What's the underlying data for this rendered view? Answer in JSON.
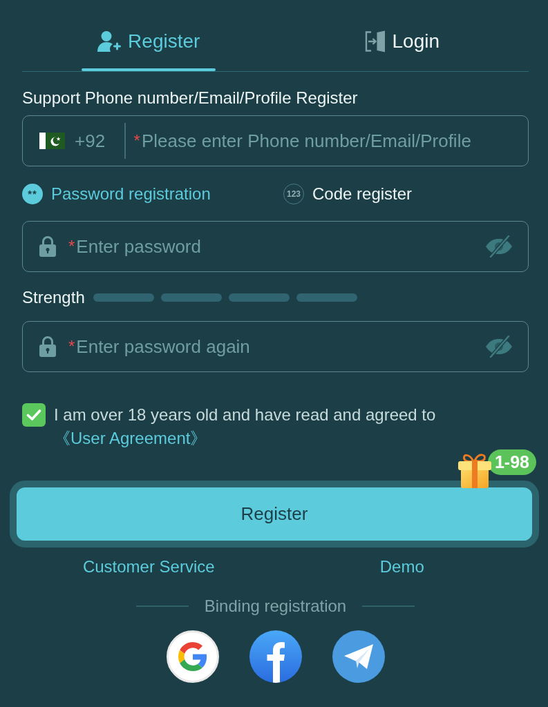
{
  "tabs": [
    {
      "label": "Register",
      "kind": "register",
      "selected": true
    },
    {
      "label": "Login",
      "kind": "login",
      "selected": false
    }
  ],
  "account": {
    "label": "Support Phone number/Email/Profile Register",
    "country_code": "+92",
    "required_mark": "*",
    "placeholder": "Please enter Phone number/Email/Profile"
  },
  "methods": [
    {
      "label": "Password registration",
      "icon_text": "**",
      "selected": true
    },
    {
      "label": "Code register",
      "icon_text": "123",
      "selected": false
    }
  ],
  "password": {
    "required_mark": "*",
    "placeholder": "Enter password"
  },
  "strength": {
    "label": "Strength",
    "segments": [
      {
        "filled": false
      },
      {
        "filled": false
      },
      {
        "filled": false
      },
      {
        "filled": false
      }
    ]
  },
  "confirm_password": {
    "required_mark": "*",
    "placeholder": "Enter password again"
  },
  "agreement": {
    "checked": true,
    "text": "I am over 18 years old and have read and agreed to ",
    "link": "《User Agreement》"
  },
  "promo_badge": {
    "label": "1-98"
  },
  "submit": {
    "label": "Register"
  },
  "links": [
    {
      "label": "Customer Service"
    },
    {
      "label": "Demo"
    }
  ],
  "binding": {
    "label": "Binding registration",
    "providers": [
      {
        "kind": "google"
      },
      {
        "kind": "facebook"
      },
      {
        "kind": "telegram"
      }
    ]
  }
}
